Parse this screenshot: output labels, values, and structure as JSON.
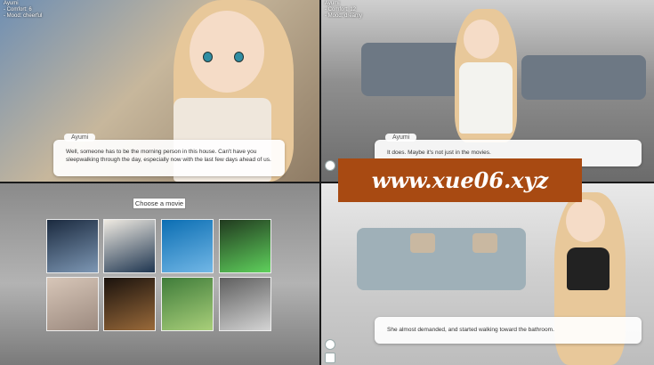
{
  "panel_top_left": {
    "hud": [
      "Ayumi",
      "- Comfort: 6",
      "- Mood: cheerful"
    ],
    "speaker": "Ayumi",
    "dialogue": "Well, someone has to be the morning person in this house. Can't have you sleepwalking through the day, especially now with the last few days ahead of us."
  },
  "panel_top_right": {
    "hud": [
      "Ayumi",
      "- Comfort: 12",
      "- Mood: dreamy"
    ],
    "speaker": "Ayumi",
    "dialogue": "It does. Maybe it's not just in the movies."
  },
  "panel_bottom_left": {
    "choose_label": "Choose a movie",
    "posters": [
      {
        "colors": [
          "#1b2a3f",
          "#7d97b4"
        ]
      },
      {
        "colors": [
          "#f0ebe2",
          "#1e3550"
        ]
      },
      {
        "colors": [
          "#0b6eb3",
          "#72b7e6"
        ]
      },
      {
        "colors": [
          "#213a1f",
          "#5fd15c"
        ]
      },
      {
        "colors": [
          "#d7c6b8",
          "#9c8a7f"
        ]
      },
      {
        "colors": [
          "#1a120d",
          "#9a6a3a"
        ]
      },
      {
        "colors": [
          "#3f7c3a",
          "#a9cf7a"
        ]
      },
      {
        "colors": [
          "#5f5f5f",
          "#d4d4d4"
        ]
      }
    ]
  },
  "panel_bottom_right": {
    "dialogue": "She almost demanded, and started walking toward the bathroom."
  },
  "watermark": "www.xue06.xyz"
}
